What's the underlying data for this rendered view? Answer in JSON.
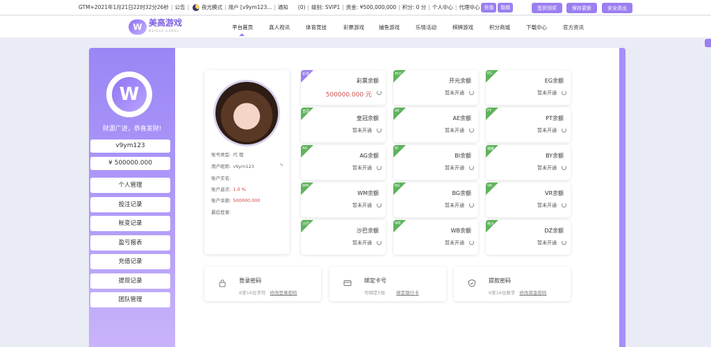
{
  "topbar": {
    "datetime": "GTM+2021年1月21日22时32分26秒",
    "notice": "公告",
    "night_mode": "夜光模式",
    "user": "用户 [v9ym123...",
    "message": "通知",
    "message_count": "(0)",
    "level": "级别: SVIP1",
    "balance": "资金: ¥500,000,000",
    "points": "积分: 0 分",
    "personal_center": "个人中心",
    "agent_center": "代理中心",
    "recharge": "充值",
    "withdraw": "取款",
    "btn_signin": "签到领奖",
    "btn_save": "保存更新",
    "btn_logout": "安全退出"
  },
  "logo": {
    "mark": "W",
    "name": "美高游戏",
    "sub": "MEIGAO GAMES"
  },
  "nav": [
    "平台首页",
    "真人视讯",
    "体育竞技",
    "彩票游戏",
    "捕鱼游戏",
    "乐情活动",
    "棋牌游戏",
    "积分商城",
    "下载中心",
    "官方资讯"
  ],
  "sidebar": {
    "slogan": "财源广进，恭喜发财!",
    "username": "v9ym123",
    "balance": "¥ 500000.000",
    "menu": [
      "个人管理",
      "投注记录",
      "帐变记录",
      "盈亏报表",
      "充值记录",
      "提现记录",
      "团队管理"
    ]
  },
  "profile": {
    "rows": [
      {
        "label": "账号类型:",
        "value": "代 理"
      },
      {
        "label": "用户昵称:",
        "value": "v9ym123"
      },
      {
        "label": "账户实名:",
        "value": ""
      },
      {
        "label": "账户返点:",
        "value": "1.0 %"
      },
      {
        "label": "账户余额:",
        "value": "500000.000"
      },
      {
        "label": "最后登录:",
        "value": ""
      }
    ]
  },
  "cards": [
    {
      "badge": "彩票",
      "name": "彩票余额",
      "value": "500000.000 元",
      "color": "purple"
    },
    {
      "badge": "开元",
      "name": "开元余额",
      "value": "暂未开通",
      "color": "green"
    },
    {
      "badge": "EG",
      "name": "EG余额",
      "value": "暂未开通",
      "color": "green"
    },
    {
      "badge": "皇冠",
      "name": "皇冠余额",
      "value": "暂未开通",
      "color": "green"
    },
    {
      "badge": "AE",
      "name": "AE余额",
      "value": "暂未开通",
      "color": "green"
    },
    {
      "badge": "PT",
      "name": "PT余额",
      "value": "暂未开通",
      "color": "green"
    },
    {
      "badge": "AG",
      "name": "AG余额",
      "value": "暂未开通",
      "color": "green"
    },
    {
      "badge": "BI",
      "name": "BI余额",
      "value": "暂未开通",
      "color": "green"
    },
    {
      "badge": "博雅",
      "name": "BY余额",
      "value": "暂未开通",
      "color": "green"
    },
    {
      "badge": "WM",
      "name": "WM余额",
      "value": "暂未开通",
      "color": "green"
    },
    {
      "badge": "BG",
      "name": "BG余额",
      "value": "暂未开通",
      "color": "green"
    },
    {
      "badge": "VR",
      "name": "VR余额",
      "value": "暂未开通",
      "color": "green"
    },
    {
      "badge": "沙巴",
      "name": "沙巴余额",
      "value": "暂未开通",
      "color": "green"
    },
    {
      "badge": "WB",
      "name": "WB余额",
      "value": "暂未开通",
      "color": "green"
    },
    {
      "badge": "电子",
      "name": "DZ余额",
      "value": "暂未开通",
      "color": "green"
    }
  ],
  "security": [
    {
      "title": "登录密码",
      "desc": "6至16位字符",
      "link": "修改登录密码",
      "icon": "lock-icon"
    },
    {
      "title": "绑定卡号",
      "desc": "可绑定5张",
      "link": "绑定银行卡",
      "icon": "card-icon"
    },
    {
      "title": "提款密码",
      "desc": "6至16位数字",
      "link": "修改资金密码",
      "icon": "shield-icon"
    }
  ]
}
